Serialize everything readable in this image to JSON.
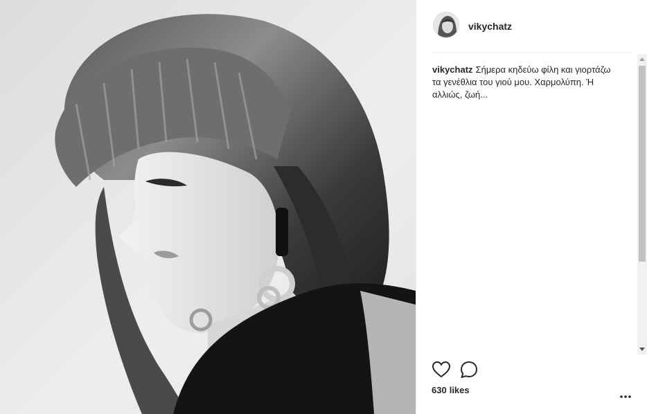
{
  "post": {
    "username": "vikychatz",
    "caption_user": "vikychatz",
    "caption_text": "Σήμερα κηδεύω φίλη και γιορτάζω τα γενέθλια του γιού μου. Χαρμολύπη. Ή αλλιώς, ζωή...",
    "likes_count": "630",
    "likes_word": "likes"
  },
  "icons": {
    "like": "heart-outline-icon",
    "comment": "speech-bubble-icon",
    "more": "ellipsis-icon"
  },
  "colors": {
    "text": "#262626",
    "divider": "#efefef",
    "scrollbar_track": "#f1f1f1",
    "scrollbar_thumb": "#c1c1c1"
  }
}
